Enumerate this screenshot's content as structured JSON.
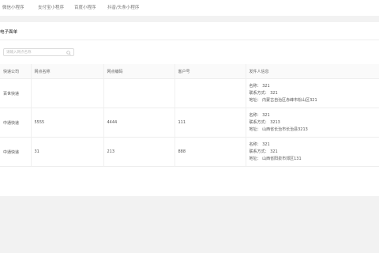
{
  "tabs": [
    {
      "label": "微信小程序"
    },
    {
      "label": "支付宝小程序"
    },
    {
      "label": "百度小程序"
    },
    {
      "label": "抖音/头条小程序"
    }
  ],
  "section": {
    "title": "电子面单"
  },
  "search": {
    "placeholder": "请输入网点名称"
  },
  "table": {
    "headers": [
      "快递公司",
      "网点名称",
      "网点编码",
      "客户号",
      "发件人信息"
    ],
    "rows": [
      {
        "company": "百世快递",
        "name": "",
        "code": "",
        "customer": "",
        "contact_name": "名称：  321",
        "contact_phone": "联系方式：  321",
        "contact_addr": "地址：  内蒙古自治区赤峰市松山区321"
      },
      {
        "company": "中通快递",
        "name": "5555",
        "code": "4444",
        "customer": "111",
        "contact_name": "名称：  321",
        "contact_phone": "联系方式：  3213",
        "contact_addr": "地址：  山西省长治市长治县3213"
      },
      {
        "company": "中通快递",
        "name": "31",
        "code": "213",
        "customer": "888",
        "contact_name": "名称：  321",
        "contact_phone": "联系方式：  321",
        "contact_addr": "地址：  山西省阳泉市郊区131"
      }
    ]
  },
  "icons": {
    "search": "search-icon"
  }
}
